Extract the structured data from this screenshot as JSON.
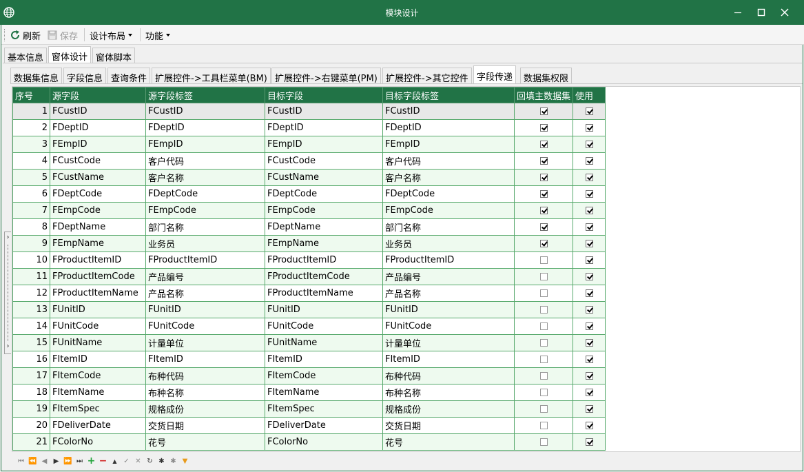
{
  "window": {
    "title": "模块设计",
    "accent_color": "#217346"
  },
  "toolbar": {
    "refresh_label": "刷新",
    "save_label": "保存",
    "layout_label": "设计布局",
    "function_label": "功能"
  },
  "top_tabs": [
    {
      "label": "基本信息",
      "active": false
    },
    {
      "label": "窗体设计",
      "active": true
    },
    {
      "label": "窗体脚本",
      "active": false
    }
  ],
  "inner_tabs": [
    {
      "label": "数据集信息",
      "active": false
    },
    {
      "label": "字段信息",
      "active": false
    },
    {
      "label": "查询条件",
      "active": false
    },
    {
      "label": "扩展控件->工具栏菜单(BM)",
      "active": false
    },
    {
      "label": "扩展控件->右键菜单(PM)",
      "active": false
    },
    {
      "label": "扩展控件->其它控件",
      "active": false
    },
    {
      "label": "字段传递",
      "active": true
    },
    {
      "label": "数据集权限",
      "active": false
    }
  ],
  "grid": {
    "columns": [
      "序号",
      "源字段",
      "源字段标签",
      "目标字段",
      "目标字段标签",
      "回填主数据集",
      "使用"
    ],
    "rows": [
      {
        "no": "1",
        "src": "FCustID",
        "src_label": "FCustID",
        "dst": "FCustID",
        "dst_label": "FCustID",
        "backfill": true,
        "use": true
      },
      {
        "no": "2",
        "src": "FDeptID",
        "src_label": "FDeptID",
        "dst": "FDeptID",
        "dst_label": "FDeptID",
        "backfill": true,
        "use": true
      },
      {
        "no": "3",
        "src": "FEmpID",
        "src_label": "FEmpID",
        "dst": "FEmpID",
        "dst_label": "FEmpID",
        "backfill": true,
        "use": true
      },
      {
        "no": "4",
        "src": "FCustCode",
        "src_label": "客户代码",
        "dst": "FCustCode",
        "dst_label": "客户代码",
        "backfill": true,
        "use": true
      },
      {
        "no": "5",
        "src": "FCustName",
        "src_label": "客户名称",
        "dst": "FCustName",
        "dst_label": "客户名称",
        "backfill": true,
        "use": true
      },
      {
        "no": "6",
        "src": "FDeptCode",
        "src_label": "FDeptCode",
        "dst": "FDeptCode",
        "dst_label": "FDeptCode",
        "backfill": true,
        "use": true
      },
      {
        "no": "7",
        "src": "FEmpCode",
        "src_label": "FEmpCode",
        "dst": "FEmpCode",
        "dst_label": "FEmpCode",
        "backfill": true,
        "use": true
      },
      {
        "no": "8",
        "src": "FDeptName",
        "src_label": "部门名称",
        "dst": "FDeptName",
        "dst_label": "部门名称",
        "backfill": true,
        "use": true
      },
      {
        "no": "9",
        "src": "FEmpName",
        "src_label": "业务员",
        "dst": "FEmpName",
        "dst_label": "业务员",
        "backfill": true,
        "use": true
      },
      {
        "no": "10",
        "src": "FProductItemID",
        "src_label": "FProductItemID",
        "dst": "FProductItemID",
        "dst_label": "FProductItemID",
        "backfill": false,
        "use": true
      },
      {
        "no": "11",
        "src": "FProductItemCode",
        "src_label": "产品编号",
        "dst": "FProductItemCode",
        "dst_label": "产品编号",
        "backfill": false,
        "use": true
      },
      {
        "no": "12",
        "src": "FProductItemName",
        "src_label": "产品名称",
        "dst": "FProductItemName",
        "dst_label": "产品名称",
        "backfill": false,
        "use": true
      },
      {
        "no": "13",
        "src": "FUnitID",
        "src_label": "FUnitID",
        "dst": "FUnitID",
        "dst_label": "FUnitID",
        "backfill": false,
        "use": true
      },
      {
        "no": "14",
        "src": "FUnitCode",
        "src_label": "FUnitCode",
        "dst": "FUnitCode",
        "dst_label": "FUnitCode",
        "backfill": false,
        "use": true
      },
      {
        "no": "15",
        "src": "FUnitName",
        "src_label": "计量单位",
        "dst": "FUnitName",
        "dst_label": "计量单位",
        "backfill": false,
        "use": true
      },
      {
        "no": "16",
        "src": "FItemID",
        "src_label": "FItemID",
        "dst": "FItemID",
        "dst_label": "FItemID",
        "backfill": false,
        "use": true
      },
      {
        "no": "17",
        "src": "FItemCode",
        "src_label": "布种代码",
        "dst": "FItemCode",
        "dst_label": "布种代码",
        "backfill": false,
        "use": true
      },
      {
        "no": "18",
        "src": "FItemName",
        "src_label": "布种名称",
        "dst": "FItemName",
        "dst_label": "布种名称",
        "backfill": false,
        "use": true
      },
      {
        "no": "19",
        "src": "FItemSpec",
        "src_label": "规格成份",
        "dst": "FItemSpec",
        "dst_label": "规格成份",
        "backfill": false,
        "use": true
      },
      {
        "no": "20",
        "src": "FDeliverDate",
        "src_label": "交货日期",
        "dst": "FDeliverDate",
        "dst_label": "交货日期",
        "backfill": false,
        "use": true
      },
      {
        "no": "21",
        "src": "FColorNo",
        "src_label": "花号",
        "dst": "FColorNo",
        "dst_label": "花号",
        "backfill": false,
        "use": true
      }
    ]
  },
  "navigator": {
    "buttons": [
      "first-icon",
      "prev-page-icon",
      "prev-icon",
      "next-icon",
      "next-page-icon",
      "last-icon",
      "plus-icon",
      "minus-icon",
      "up-icon",
      "check-icon",
      "cancel-icon",
      "refresh-icon",
      "asterisk-icon",
      "asterisk-gray-icon",
      "filter-icon"
    ]
  }
}
